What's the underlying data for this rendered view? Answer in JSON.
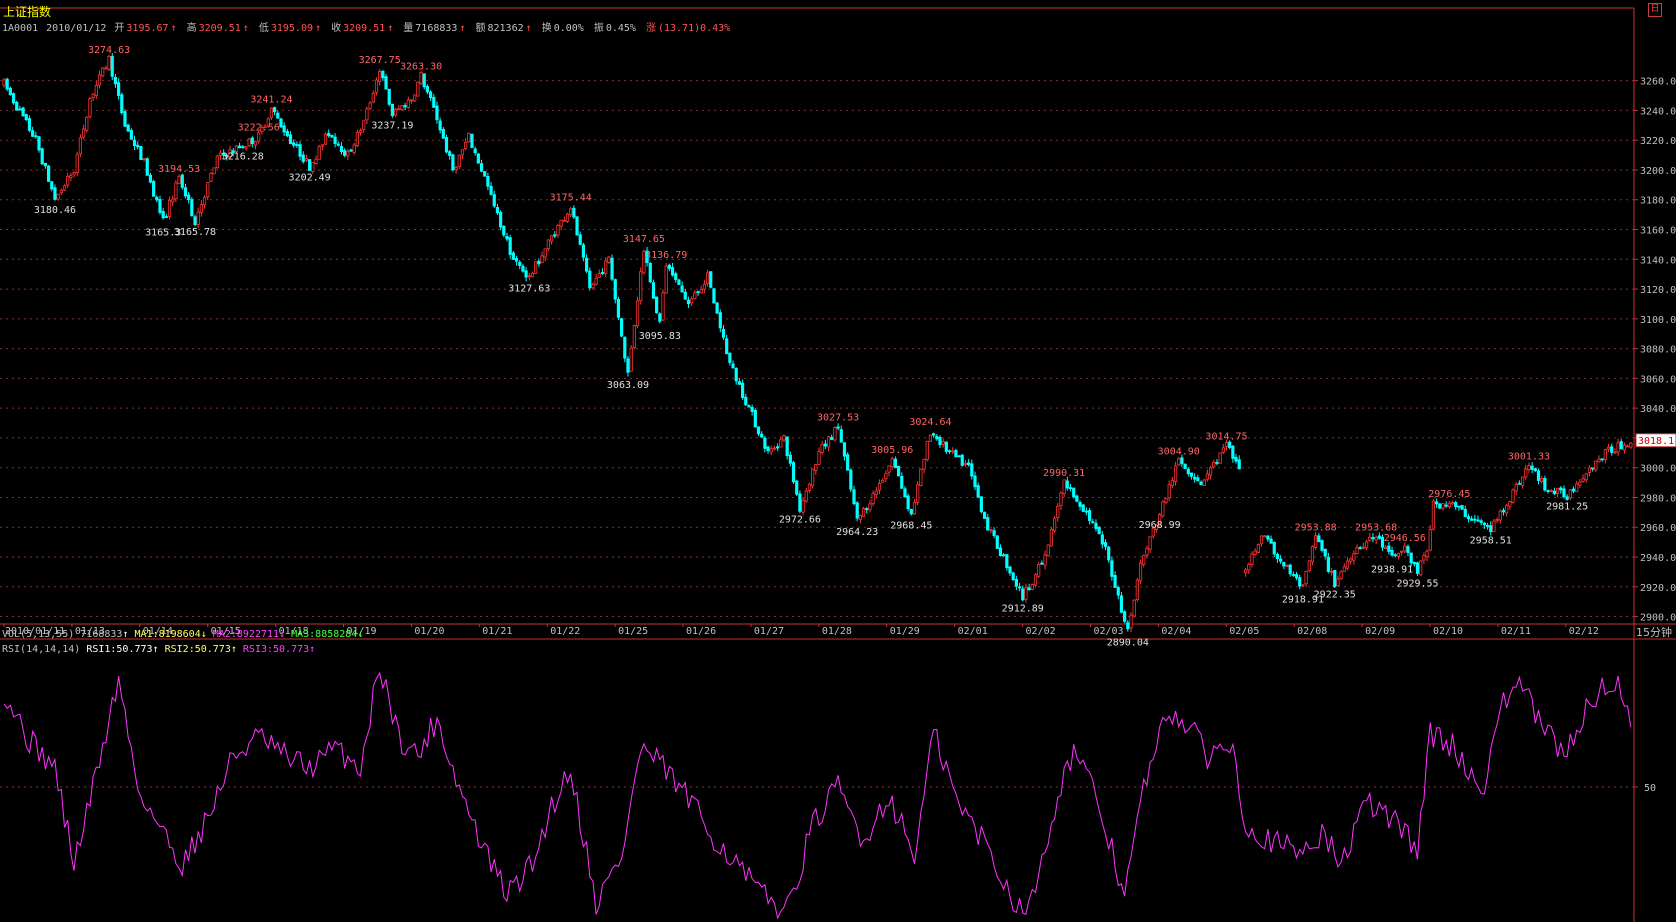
{
  "title": "上证指数",
  "close_symbol": "日",
  "infobar": {
    "code": "1A0001",
    "date": "2010/01/12",
    "open_label": "开",
    "open": "3195.67",
    "high_label": "高",
    "high": "3209.51",
    "low_label": "低",
    "low": "3195.09",
    "close_label": "收",
    "close": "3209.51",
    "vol_label": "量",
    "vol": "7168833",
    "amt_label": "额",
    "amt": "821362",
    "turnover_label": "换",
    "turnover": "0.00%",
    "amp_label": "振",
    "amp": "0.45%",
    "chg_label": "涨",
    "chg": "(13.71)0.43%"
  },
  "vol_bar": {
    "label": "VOL(5,13,55)",
    "vol": "7168833",
    "ma1": "MA1:8198604",
    "ma2": "MA2:8922711",
    "ma3": "MA3:8858284"
  },
  "rsi_bar": {
    "label": "RSI(14,14,14)",
    "rsi1": "RSI1:50.773",
    "rsi2": "RSI2:50.773",
    "rsi3": "RSI3:50.773"
  },
  "frequency": "15分钟",
  "colors": {
    "up": "#ff3333",
    "down": "#00ffff",
    "axis": "#c83232",
    "rsi": "#ff33ff",
    "grid": "#803030",
    "hi_label": "#ff6666",
    "lo_label": "#e0e0e0"
  },
  "chart_data": [
    {
      "type": "candlestick",
      "x_unit": "15-minute bars, 16 per trading day",
      "ylim": [
        2895,
        3290
      ],
      "yticks": [
        "2900.0",
        "2920.0",
        "2940.0",
        "2960.0",
        "2980.0",
        "3000.0",
        "3020.0",
        "3040.0",
        "3060.0",
        "3080.0",
        "3100.0",
        "3120.0",
        "3140.0",
        "3160.0",
        "3180.0",
        "3200.0",
        "3220.0",
        "3240.0",
        "3260.0"
      ],
      "last_price": "3018.1",
      "dates": [
        "2010/01/11",
        "01/13",
        "01/14",
        "01/15",
        "01/18",
        "01/19",
        "01/20",
        "01/21",
        "01/22",
        "01/25",
        "01/26",
        "01/27",
        "01/28",
        "01/29",
        "02/01",
        "02/02",
        "02/03",
        "02/04",
        "02/05",
        "02/08",
        "02/09",
        "02/10",
        "02/11",
        "02/12"
      ],
      "anchors": [
        [
          0,
          3258
        ],
        [
          10,
          3220
        ],
        [
          16,
          3180.46
        ],
        [
          22,
          3200
        ],
        [
          27,
          3248
        ],
        [
          33,
          3274.63
        ],
        [
          38,
          3230
        ],
        [
          44,
          3205
        ],
        [
          50,
          3165.3
        ],
        [
          55,
          3194.53
        ],
        [
          60,
          3165.78
        ],
        [
          67,
          3208
        ],
        [
          75,
          3216.28
        ],
        [
          80,
          3222.56
        ],
        [
          84,
          3241.24
        ],
        [
          90,
          3220
        ],
        [
          96,
          3202.49
        ],
        [
          102,
          3225
        ],
        [
          108,
          3210
        ],
        [
          113,
          3232
        ],
        [
          118,
          3267.75
        ],
        [
          122,
          3237.19
        ],
        [
          128,
          3248
        ],
        [
          131,
          3263.3
        ],
        [
          136,
          3235
        ],
        [
          141,
          3200
        ],
        [
          146,
          3222
        ],
        [
          151,
          3195
        ],
        [
          154,
          3175
        ],
        [
          160,
          3140
        ],
        [
          165,
          3127.63
        ],
        [
          172,
          3155
        ],
        [
          178,
          3175.44
        ],
        [
          184,
          3120
        ],
        [
          190,
          3140
        ],
        [
          196,
          3063.09
        ],
        [
          201,
          3147.65
        ],
        [
          206,
          3095.83
        ],
        [
          208,
          3136.79
        ],
        [
          215,
          3110
        ],
        [
          221,
          3128
        ],
        [
          228,
          3070
        ],
        [
          234,
          3040
        ],
        [
          240,
          3010
        ],
        [
          245,
          3020
        ],
        [
          250,
          2972.66
        ],
        [
          256,
          3010
        ],
        [
          262,
          3027.53
        ],
        [
          268,
          2964.23
        ],
        [
          274,
          2985
        ],
        [
          279,
          3005.96
        ],
        [
          285,
          2968.45
        ],
        [
          291,
          3024.64
        ],
        [
          297,
          3010
        ],
        [
          303,
          3000
        ],
        [
          309,
          2960
        ],
        [
          315,
          2935
        ],
        [
          320,
          2912.89
        ],
        [
          327,
          2940
        ],
        [
          333,
          2990.31
        ],
        [
          340,
          2970
        ],
        [
          346,
          2945
        ],
        [
          353,
          2890.04
        ],
        [
          357,
          2935
        ],
        [
          363,
          2968.99
        ],
        [
          369,
          3004.9
        ],
        [
          376,
          2990
        ],
        [
          384,
          3014.75
        ],
        [
          388,
          3000
        ],
        [
          390,
          2930
        ],
        [
          395,
          2955
        ],
        [
          402,
          2935
        ],
        [
          408,
          2918.91
        ],
        [
          412,
          2953.88
        ],
        [
          418,
          2922.35
        ],
        [
          424,
          2945
        ],
        [
          431,
          2953.68
        ],
        [
          436,
          2938.91
        ],
        [
          440,
          2946.56
        ],
        [
          444,
          2929.55
        ],
        [
          447,
          2945
        ],
        [
          449,
          2975
        ],
        [
          454,
          2976.45
        ],
        [
          461,
          2966
        ],
        [
          467,
          2958.51
        ],
        [
          473,
          2980
        ],
        [
          479,
          3001.33
        ],
        [
          485,
          2985
        ],
        [
          491,
          2981.25
        ],
        [
          497,
          2998
        ],
        [
          503,
          3010
        ],
        [
          511,
          3018.1
        ]
      ],
      "annotations": [
        {
          "text": "3274.63",
          "i": 33,
          "v": 3274.63,
          "kind": "high"
        },
        {
          "text": "3180.46",
          "i": 16,
          "v": 3180.46,
          "kind": "low"
        },
        {
          "text": "3241.24",
          "i": 84,
          "v": 3241.24,
          "kind": "high"
        },
        {
          "text": "3222.56",
          "i": 80,
          "v": 3222.56,
          "kind": "high"
        },
        {
          "text": "3216.28",
          "i": 75,
          "v": 3216.28,
          "kind": "low"
        },
        {
          "text": "3194.53",
          "i": 55,
          "v": 3194.53,
          "kind": "high"
        },
        {
          "text": "3165.3",
          "i": 50,
          "v": 3165.3,
          "kind": "low"
        },
        {
          "text": "3165.78",
          "i": 60,
          "v": 3165.78,
          "kind": "low"
        },
        {
          "text": "3202.49",
          "i": 96,
          "v": 3202.49,
          "kind": "low"
        },
        {
          "text": "3267.75",
          "i": 118,
          "v": 3267.75,
          "kind": "high"
        },
        {
          "text": "3263.30",
          "i": 131,
          "v": 3263.3,
          "kind": "high"
        },
        {
          "text": "3237.19",
          "i": 122,
          "v": 3237.19,
          "kind": "low"
        },
        {
          "text": "3175.44",
          "i": 178,
          "v": 3175.44,
          "kind": "high"
        },
        {
          "text": "3127.63",
          "i": 165,
          "v": 3127.63,
          "kind": "low"
        },
        {
          "text": "3147.65",
          "i": 201,
          "v": 3147.65,
          "kind": "high"
        },
        {
          "text": "3136.79",
          "i": 208,
          "v": 3136.79,
          "kind": "high"
        },
        {
          "text": "3095.83",
          "i": 206,
          "v": 3095.83,
          "kind": "low"
        },
        {
          "text": "3063.09",
          "i": 196,
          "v": 3063.09,
          "kind": "low"
        },
        {
          "text": "3027.53",
          "i": 262,
          "v": 3027.53,
          "kind": "high"
        },
        {
          "text": "2972.66",
          "i": 250,
          "v": 2972.66,
          "kind": "low"
        },
        {
          "text": "3005.96",
          "i": 279,
          "v": 3005.96,
          "kind": "high"
        },
        {
          "text": "2964.23",
          "i": 268,
          "v": 2964.23,
          "kind": "low"
        },
        {
          "text": "3024.64",
          "i": 291,
          "v": 3024.64,
          "kind": "high"
        },
        {
          "text": "2968.45",
          "i": 285,
          "v": 2968.45,
          "kind": "low"
        },
        {
          "text": "2990.31",
          "i": 333,
          "v": 2990.31,
          "kind": "high"
        },
        {
          "text": "2912.89",
          "i": 320,
          "v": 2912.89,
          "kind": "low"
        },
        {
          "text": "2890.04",
          "i": 353,
          "v": 2890.04,
          "kind": "low"
        },
        {
          "text": "3004.90",
          "i": 369,
          "v": 3004.9,
          "kind": "high"
        },
        {
          "text": "2968.99",
          "i": 363,
          "v": 2968.99,
          "kind": "low"
        },
        {
          "text": "3014.75",
          "i": 384,
          "v": 3014.75,
          "kind": "high"
        },
        {
          "text": "2953.88",
          "i": 412,
          "v": 2953.88,
          "kind": "high"
        },
        {
          "text": "2918.91",
          "i": 408,
          "v": 2918.91,
          "kind": "low"
        },
        {
          "text": "2922.35",
          "i": 418,
          "v": 2922.35,
          "kind": "low"
        },
        {
          "text": "2953.68",
          "i": 431,
          "v": 2953.68,
          "kind": "high"
        },
        {
          "text": "2938.91",
          "i": 436,
          "v": 2938.91,
          "kind": "low"
        },
        {
          "text": "2946.56",
          "i": 440,
          "v": 2946.56,
          "kind": "high"
        },
        {
          "text": "2929.55",
          "i": 444,
          "v": 2929.55,
          "kind": "low"
        },
        {
          "text": "2976.45",
          "i": 454,
          "v": 2976.45,
          "kind": "high"
        },
        {
          "text": "2958.51",
          "i": 467,
          "v": 2958.51,
          "kind": "low"
        },
        {
          "text": "3001.33",
          "i": 479,
          "v": 3001.33,
          "kind": "high"
        },
        {
          "text": "2981.25",
          "i": 491,
          "v": 2981.25,
          "kind": "low"
        }
      ]
    },
    {
      "type": "line",
      "name": "RSI(14,14,14)",
      "ylim": [
        15,
        85
      ],
      "yticks": [
        "50"
      ],
      "anchors": [
        [
          0,
          75
        ],
        [
          8,
          62
        ],
        [
          16,
          55
        ],
        [
          22,
          30
        ],
        [
          28,
          50
        ],
        [
          36,
          78
        ],
        [
          42,
          50
        ],
        [
          50,
          38
        ],
        [
          56,
          30
        ],
        [
          64,
          42
        ],
        [
          72,
          58
        ],
        [
          80,
          63
        ],
        [
          88,
          58
        ],
        [
          96,
          55
        ],
        [
          104,
          60
        ],
        [
          112,
          55
        ],
        [
          118,
          82
        ],
        [
          124,
          63
        ],
        [
          130,
          58
        ],
        [
          136,
          68
        ],
        [
          142,
          52
        ],
        [
          150,
          35
        ],
        [
          158,
          22
        ],
        [
          166,
          30
        ],
        [
          172,
          45
        ],
        [
          178,
          55
        ],
        [
          186,
          20
        ],
        [
          194,
          32
        ],
        [
          200,
          60
        ],
        [
          206,
          56
        ],
        [
          214,
          48
        ],
        [
          222,
          38
        ],
        [
          230,
          30
        ],
        [
          238,
          22
        ],
        [
          246,
          18
        ],
        [
          254,
          40
        ],
        [
          262,
          50
        ],
        [
          270,
          36
        ],
        [
          278,
          48
        ],
        [
          286,
          32
        ],
        [
          292,
          64
        ],
        [
          300,
          45
        ],
        [
          308,
          36
        ],
        [
          316,
          22
        ],
        [
          322,
          18
        ],
        [
          330,
          45
        ],
        [
          336,
          60
        ],
        [
          344,
          45
        ],
        [
          352,
          22
        ],
        [
          358,
          50
        ],
        [
          366,
          70
        ],
        [
          372,
          66
        ],
        [
          378,
          58
        ],
        [
          386,
          62
        ],
        [
          390,
          40
        ],
        [
          398,
          36
        ],
        [
          406,
          33
        ],
        [
          414,
          38
        ],
        [
          420,
          30
        ],
        [
          428,
          46
        ],
        [
          436,
          42
        ],
        [
          444,
          34
        ],
        [
          448,
          64
        ],
        [
          456,
          60
        ],
        [
          464,
          48
        ],
        [
          470,
          70
        ],
        [
          476,
          78
        ],
        [
          482,
          67
        ],
        [
          490,
          58
        ],
        [
          498,
          72
        ],
        [
          506,
          78
        ],
        [
          511,
          66
        ]
      ]
    }
  ]
}
